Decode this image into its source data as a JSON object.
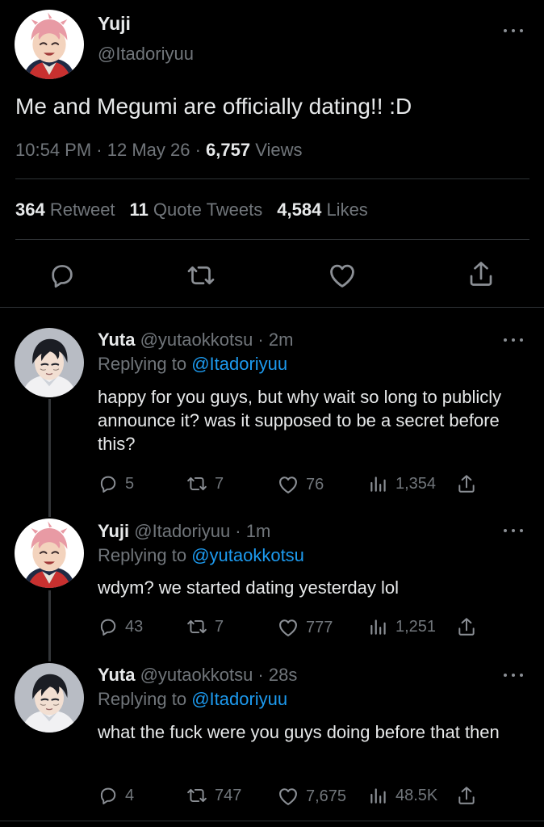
{
  "main": {
    "name": "Yuji",
    "handle": "@Itadoriyuu",
    "text": "Me and Megumi are officially dating!! :D",
    "time": "10:54 PM",
    "sep1": " · ",
    "date": "12 May 26",
    "sep2": " · ",
    "views_count": "6,757",
    "views_label": " Views",
    "retweets_count": "364",
    "retweets_label": " Retweet",
    "quotes_count": "11",
    "quotes_label": " Quote Tweets",
    "likes_count": "4,584",
    "likes_label": " Likes"
  },
  "replies": [
    {
      "name": "Yuta",
      "meta": " @yutaokkotsu · 2m",
      "replying_prefix": "Replying to ",
      "replying_to": "@Itadoriyuu",
      "text": "happy for you guys, but why wait so long to publicly announce it? was it supposed to be a secret before this?",
      "replies": "5",
      "retweets": "7",
      "likes": "76",
      "views": "1,354"
    },
    {
      "name": "Yuji",
      "meta": " @Itadoriyuu · 1m",
      "replying_prefix": "Replying to ",
      "replying_to": "@yutaokkotsu",
      "text": "wdym? we started dating yesterday lol",
      "replies": "43",
      "retweets": "7",
      "likes": "777",
      "views": "1,251"
    },
    {
      "name": "Yuta",
      "meta": " @yutaokkotsu · 28s",
      "replying_prefix": "Replying to ",
      "replying_to": "@Itadoriyuu",
      "text": "what the fuck were you guys doing before that then",
      "replies": "4",
      "retweets": "747",
      "likes": "7,675",
      "views": "48.5K"
    }
  ],
  "icons": {
    "reply": "reply-icon",
    "retweet": "retweet-icon",
    "like": "heart-icon",
    "views": "views-icon",
    "share": "share-icon",
    "more": "more-icon"
  },
  "colors": {
    "background": "#000000",
    "text": "#e7e9ea",
    "muted": "#71767b",
    "link": "#1d9bf0",
    "divider": "#2f3336"
  }
}
